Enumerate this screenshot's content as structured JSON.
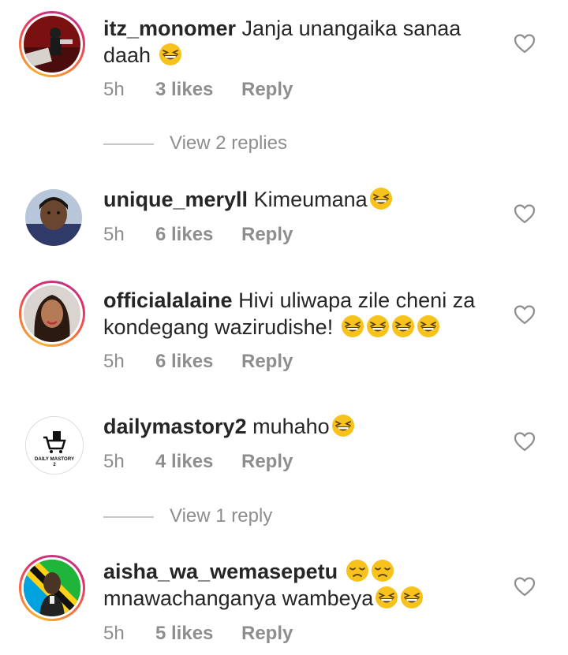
{
  "comments": [
    {
      "username": "itz_monomer",
      "text_line1": "Janja unangaika sanaa",
      "text_line2": "daah",
      "time": "5h",
      "likes": "3 likes",
      "reply": "Reply",
      "emoji_line2": [
        "laughing-emoji"
      ]
    },
    {
      "username": "unique_meryll",
      "text_line1": "Kimeumana",
      "time": "5h",
      "likes": "6 likes",
      "reply": "Reply"
    },
    {
      "username": "officialalaine",
      "text_line1": "Hivi uliwapa zile cheni za",
      "text_line2": "kondegang wazirudishe!",
      "time": "5h",
      "likes": "6 likes",
      "reply": "Reply"
    },
    {
      "username": "dailymastory2",
      "text_line1": "muhaho",
      "time": "5h",
      "likes": "4 likes",
      "reply": "Reply",
      "avatar_text": "DAILY MASTORY",
      "avatar_num": "2"
    },
    {
      "username": "aisha_wa_wemasepetu",
      "text_line2": "mnawachanganya wambeya",
      "time": "5h",
      "likes": "5 likes",
      "reply": "Reply"
    }
  ],
  "view_replies": [
    "View 2 replies",
    "View 1 reply"
  ],
  "icons": {
    "like": "heart-outline-icon",
    "laugh": "grinning-squinting-emoji",
    "sad": "pensive-emoji"
  },
  "colors": {
    "text": "#262626",
    "meta": "#8e8e8e",
    "story_ring": "#e1306c"
  }
}
